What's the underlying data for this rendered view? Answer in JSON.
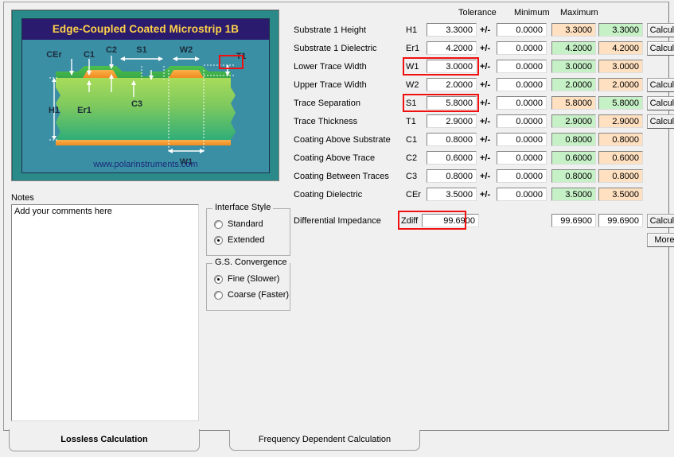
{
  "window": {
    "title": "Edge-Coupled Coated Microstrip 1B"
  },
  "diagram": {
    "title": "Edge-Coupled Coated Microstrip 1B",
    "url": "www.polarinstruments.com",
    "labels": {
      "cer": "CEr",
      "c1": "C1",
      "c2": "C2",
      "c3": "C3",
      "s1": "S1",
      "w1": "W1",
      "w2": "W2",
      "t1": "T1",
      "h1": "H1",
      "er1": "Er1"
    },
    "colors": {
      "banner_bg": "#2b1b6e",
      "banner_text": "#ffd24a",
      "canvas_bg": "#3b8fa5",
      "outer_bg": "#2a8a8a",
      "substrate_top": "#8fd14f",
      "substrate_bottom": "#3cb371",
      "trace": "#f0962d",
      "coating": "#4cb050",
      "url_text": "#1a2a7a"
    }
  },
  "notes": {
    "label": "Notes",
    "value": "Add your comments here",
    "placeholder": "Add your comments here"
  },
  "interface_style": {
    "legend": "Interface Style",
    "options": [
      {
        "label": "Standard",
        "selected": false
      },
      {
        "label": "Extended",
        "selected": true
      }
    ]
  },
  "gs_convergence": {
    "legend": "G.S. Convergence",
    "options": [
      {
        "label": "Fine (Slower)",
        "selected": true
      },
      {
        "label": "Coarse (Faster)",
        "selected": false
      }
    ]
  },
  "params": {
    "headers": {
      "tolerance": "Tolerance",
      "minimum": "Minimum",
      "maximum": "Maximum"
    },
    "plusminus": "+/-",
    "calculate_label": "Calculate",
    "rows": [
      {
        "label": "Substrate 1 Height",
        "symbol": "H1",
        "value": "3.3000",
        "tolerance": "0.0000",
        "minimum": "3.3000",
        "maximum": "3.3000",
        "min_color": "orange",
        "max_color": "green",
        "has_calculate": true,
        "highlighted": false
      },
      {
        "label": "Substrate 1 Dielectric",
        "symbol": "Er1",
        "value": "4.2000",
        "tolerance": "0.0000",
        "minimum": "4.2000",
        "maximum": "4.2000",
        "min_color": "green",
        "max_color": "orange",
        "has_calculate": true,
        "highlighted": false
      },
      {
        "label": "Lower Trace Width",
        "symbol": "W1",
        "value": "3.0000",
        "tolerance": "0.0000",
        "minimum": "3.0000",
        "maximum": "3.0000",
        "min_color": "green",
        "max_color": "orange",
        "has_calculate": false,
        "highlighted": true
      },
      {
        "label": "Upper Trace Width",
        "symbol": "W2",
        "value": "2.0000",
        "tolerance": "0.0000",
        "minimum": "2.0000",
        "maximum": "2.0000",
        "min_color": "green",
        "max_color": "orange",
        "has_calculate": true,
        "highlighted": false
      },
      {
        "label": "Trace Separation",
        "symbol": "S1",
        "value": "5.8000",
        "tolerance": "0.0000",
        "minimum": "5.8000",
        "maximum": "5.8000",
        "min_color": "orange",
        "max_color": "green",
        "has_calculate": true,
        "highlighted": true
      },
      {
        "label": "Trace Thickness",
        "symbol": "T1",
        "value": "2.9000",
        "tolerance": "0.0000",
        "minimum": "2.9000",
        "maximum": "2.9000",
        "min_color": "green",
        "max_color": "orange",
        "has_calculate": true,
        "highlighted": false
      },
      {
        "label": "Coating Above Substrate",
        "symbol": "C1",
        "value": "0.8000",
        "tolerance": "0.0000",
        "minimum": "0.8000",
        "maximum": "0.8000",
        "min_color": "green",
        "max_color": "orange",
        "has_calculate": false,
        "highlighted": false
      },
      {
        "label": "Coating Above Trace",
        "symbol": "C2",
        "value": "0.6000",
        "tolerance": "0.0000",
        "minimum": "0.6000",
        "maximum": "0.6000",
        "min_color": "green",
        "max_color": "orange",
        "has_calculate": false,
        "highlighted": false
      },
      {
        "label": "Coating Between Traces",
        "symbol": "C3",
        "value": "0.8000",
        "tolerance": "0.0000",
        "minimum": "0.8000",
        "maximum": "0.8000",
        "min_color": "green",
        "max_color": "orange",
        "has_calculate": false,
        "highlighted": false
      },
      {
        "label": "Coating Dielectric",
        "symbol": "CEr",
        "value": "3.5000",
        "tolerance": "0.0000",
        "minimum": "3.5000",
        "maximum": "3.5000",
        "min_color": "green",
        "max_color": "orange",
        "has_calculate": false,
        "highlighted": false
      }
    ]
  },
  "result": {
    "label": "Differential Impedance",
    "symbol": "Zdiff",
    "value": "99.6900",
    "minimum": "99.6900",
    "maximum": "99.6900",
    "min_color": "orange",
    "max_color": "green",
    "calculate_label": "Calculate",
    "more_label": "More..."
  },
  "tabs": [
    {
      "label": "Lossless Calculation",
      "active": true
    },
    {
      "label": "Frequency Dependent Calculation",
      "active": false
    }
  ],
  "annotation": {
    "color": "#f01010"
  }
}
